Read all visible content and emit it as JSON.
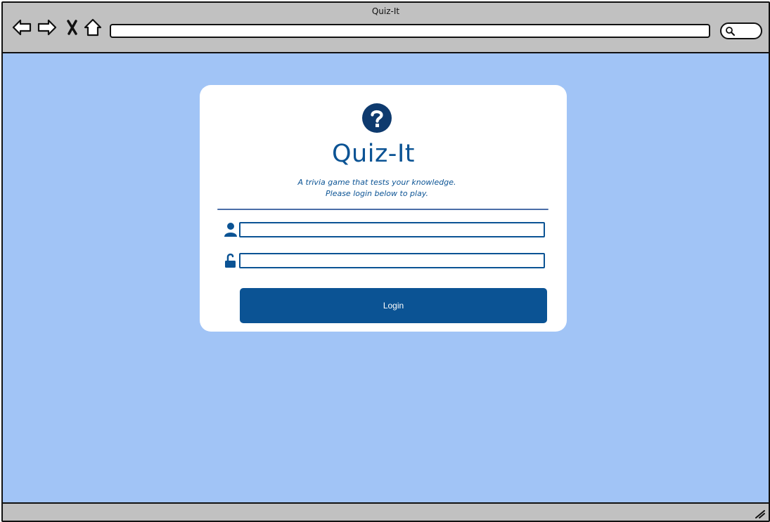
{
  "window": {
    "title": "Quiz-It"
  },
  "browser": {
    "nav_icons": [
      "back-arrow-icon",
      "forward-arrow-icon",
      "close-x-icon",
      "home-icon"
    ],
    "url_value": "",
    "search_icon": "search-icon"
  },
  "card": {
    "logo_icon": "question-circle-icon",
    "title": "Quiz-It",
    "tagline_line1": "A trivia game that tests your knowledge.",
    "tagline_line2": "Please login below to play.",
    "username": {
      "icon": "user-icon",
      "value": "",
      "placeholder": ""
    },
    "password": {
      "icon": "unlock-icon",
      "value": "",
      "placeholder": ""
    },
    "login_label": "Login"
  },
  "colors": {
    "page_background": "#a1c4f6",
    "accent": "#0b5394",
    "chrome": "#c1c1c1",
    "card": "#ffffff"
  }
}
